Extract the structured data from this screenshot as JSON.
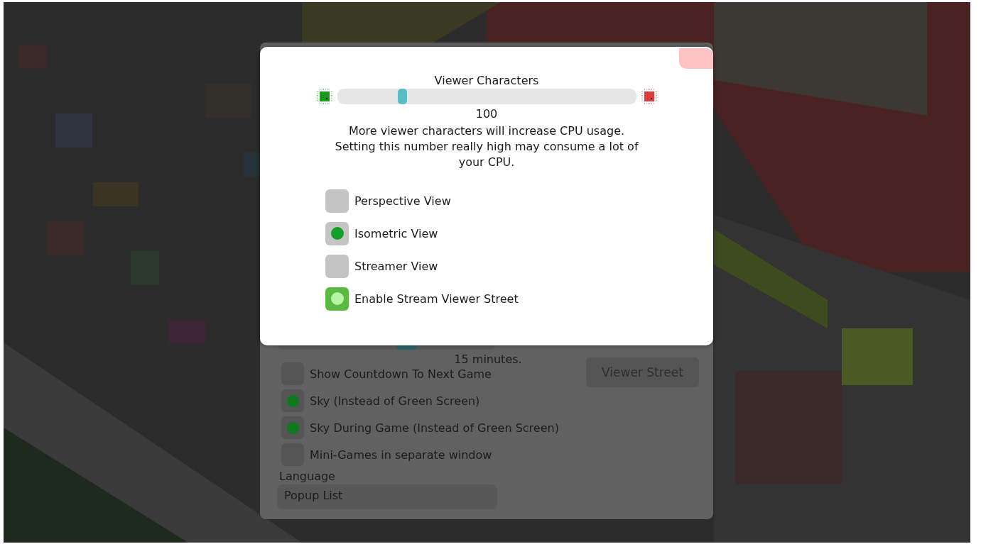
{
  "settings_panel": {
    "slider": {
      "level": 0.6
    },
    "note": "15 minutes.",
    "options": [
      {
        "label": "Show Countdown To Next Game",
        "checked": false
      },
      {
        "label": "Sky (Instead of Green Screen)",
        "checked": true
      },
      {
        "label": "Sky During Game (Instead of Green Screen)",
        "checked": true
      },
      {
        "label": "Mini-Games in separate window",
        "checked": false
      }
    ],
    "side_button": "Viewer Street",
    "language": {
      "label": "Language",
      "value": "Popup List"
    }
  },
  "dialog": {
    "title": "Viewer Characters",
    "slider": {
      "level": 0.21
    },
    "value": "100",
    "description": "More viewer characters will increase CPU usage. Setting this number really high may consume a lot of your CPU.",
    "options": [
      {
        "kind": "radio",
        "label": "Perspective View",
        "selected": false
      },
      {
        "kind": "radio",
        "label": "Isometric View",
        "selected": true
      },
      {
        "kind": "radio",
        "label": "Streamer View",
        "selected": false
      },
      {
        "kind": "toggle",
        "label": "Enable Stream Viewer Street",
        "checked": true
      }
    ]
  }
}
